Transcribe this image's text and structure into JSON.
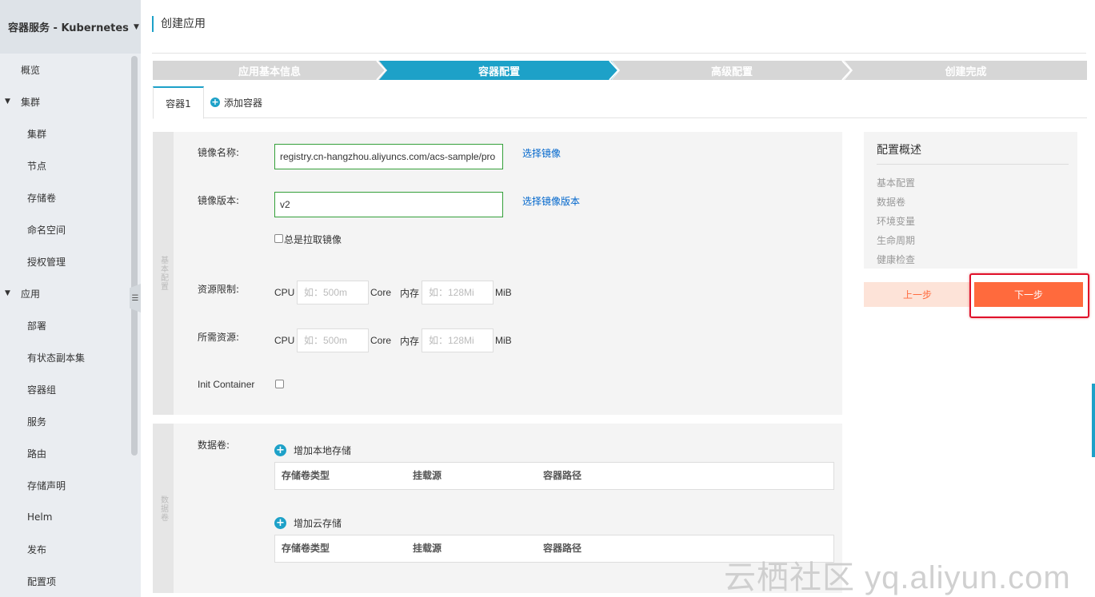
{
  "sidebar": {
    "title": "容器服务 - Kubernetes",
    "items": [
      {
        "label": "概览"
      },
      {
        "label": "集群"
      },
      {
        "label": "集群"
      },
      {
        "label": "节点"
      },
      {
        "label": "存储卷"
      },
      {
        "label": "命名空间"
      },
      {
        "label": "授权管理"
      },
      {
        "label": "应用"
      },
      {
        "label": "部署"
      },
      {
        "label": "有状态副本集"
      },
      {
        "label": "容器组"
      },
      {
        "label": "服务"
      },
      {
        "label": "路由"
      },
      {
        "label": "存储声明"
      },
      {
        "label": "Helm"
      },
      {
        "label": "发布"
      },
      {
        "label": "配置项"
      }
    ]
  },
  "page": {
    "title": "创建应用"
  },
  "steps": [
    {
      "label": "应用基本信息"
    },
    {
      "label": "容器配置"
    },
    {
      "label": "高级配置"
    },
    {
      "label": "创建完成"
    }
  ],
  "tabs": {
    "container1": "容器1",
    "add_container": "添加容器"
  },
  "basic": {
    "section": "基本配置",
    "image_name_label": "镜像名称:",
    "image_name_value": "registry.cn-hangzhou.aliyuncs.com/acs-sample/pro",
    "select_image": "选择镜像",
    "image_version_label": "镜像版本:",
    "image_version_value": "v2",
    "select_image_version": "选择镜像版本",
    "always_pull": "总是拉取镜像",
    "resource_limit_label": "资源限制:",
    "resource_request_label": "所需资源:",
    "cpu": "CPU",
    "cpu_placeholder": "如：500m",
    "core": "Core",
    "memory": "内存",
    "mem_placeholder": "如：128Mi",
    "mib": "MiB",
    "init_container": "Init Container"
  },
  "volumes": {
    "section": "数据卷",
    "label": "数据卷:",
    "add_local": "增加本地存储",
    "add_cloud": "增加云存储",
    "col_type": "存储卷类型",
    "col_source": "挂载源",
    "col_path": "容器路径"
  },
  "summary": {
    "title": "配置概述",
    "items": [
      "基本配置",
      "数据卷",
      "环境变量",
      "生命周期",
      "健康检查"
    ]
  },
  "buttons": {
    "prev": "上一步",
    "next": "下一步"
  },
  "watermark": "云栖社区 yq.aliyun.com",
  "colors": {
    "accent": "#1da1c8",
    "primary_button": "#ff6a3d",
    "highlight": "#e0102a"
  }
}
